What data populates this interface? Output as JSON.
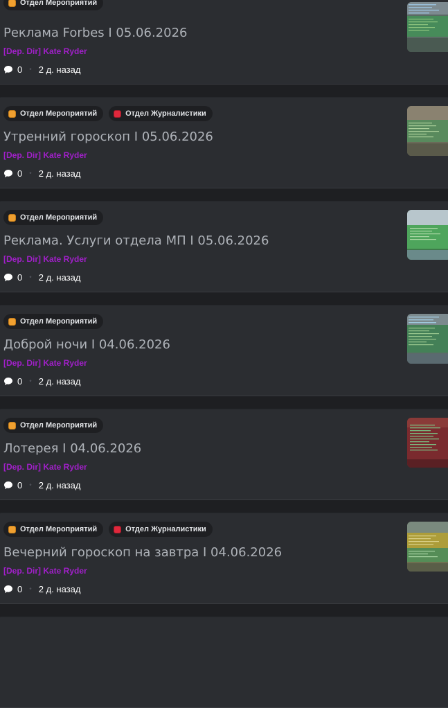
{
  "posts": [
    {
      "tags": [
        {
          "label": "Отдел Мероприятий",
          "color": "orange"
        }
      ],
      "title": "Реклама Forbes I 05.06.2026",
      "author": "[Dep. Dir] Kate Ryder",
      "comments": "0",
      "time": "2 д. назад",
      "thumb": {
        "base": "#5a6a64",
        "accent": "#3f9a55",
        "top": "#7d8a90"
      }
    },
    {
      "tags": [
        {
          "label": "Отдел Мероприятий",
          "color": "orange"
        },
        {
          "label": "Отдел Журналистики",
          "color": "red"
        }
      ],
      "title": "Утренний гороскоп I 05.06.2026",
      "author": "[Dep. Dir] Kate Ryder",
      "comments": "0",
      "time": "2 д. назад",
      "thumb": {
        "base": "#6a6a58",
        "accent": "#4fa060",
        "top": "#8a8270"
      }
    },
    {
      "tags": [
        {
          "label": "Отдел Мероприятий",
          "color": "orange"
        }
      ],
      "title": "Реклама. Услуги отдела МП I 05.06.2026",
      "author": "[Dep. Dir] Kate Ryder",
      "comments": "0",
      "time": "2 д. назад",
      "thumb": {
        "base": "#3e7a4a",
        "accent": "#52b060",
        "top": "#b8c6cc"
      }
    },
    {
      "tags": [
        {
          "label": "Отдел Мероприятий",
          "color": "orange"
        }
      ],
      "title": "Доброй ночи I 04.06.2026",
      "author": "[Dep. Dir] Kate Ryder",
      "comments": "0",
      "time": "2 д. назад",
      "thumb": {
        "base": "#5b6a6a",
        "accent": "#3a8a50",
        "top": "#7c8a8e"
      }
    },
    {
      "tags": [
        {
          "label": "Отдел Мероприятий",
          "color": "orange"
        }
      ],
      "title": "Лотерея I 04.06.2026",
      "author": "[Dep. Dir] Kate Ryder",
      "comments": "0",
      "time": "2 д. назад",
      "thumb": {
        "base": "#7a2a2e",
        "accent": "#3c9a50",
        "top": "#8a3a38"
      }
    },
    {
      "tags": [
        {
          "label": "Отдел Мероприятий",
          "color": "orange"
        },
        {
          "label": "Отдел Журналистики",
          "color": "red"
        }
      ],
      "title": "Вечерний гороскоп на завтра I 04.06.2026",
      "author": "[Dep. Dir] Kate Ryder",
      "comments": "0",
      "time": "2 д. назад",
      "thumb": {
        "base": "#6e7050",
        "accent": "#c8b030",
        "top": "#7a8a7e"
      }
    }
  ],
  "icons": {
    "tag": "tag-square-icon",
    "comment": "speech-bubble-icon"
  }
}
